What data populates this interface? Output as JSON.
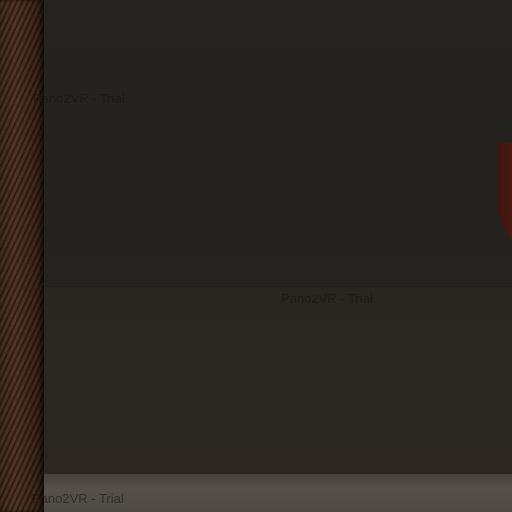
{
  "viewer": {
    "watermarks": [
      "Pano2VR - Trial",
      "Pano2VR - Trial",
      "Pano2VR - Trial"
    ]
  },
  "colors": {
    "wall": "#252420",
    "wood": "#4a2f1c",
    "floor": "#55514a",
    "accent_red": "#4a1a12"
  }
}
